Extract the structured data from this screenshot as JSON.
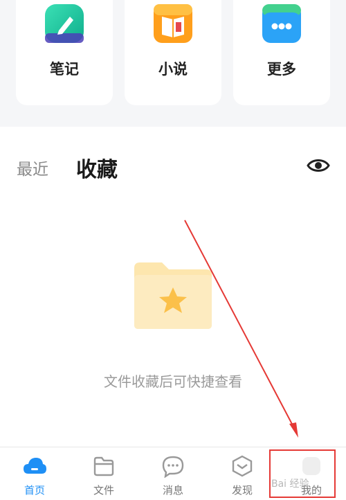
{
  "shortcuts": [
    {
      "label": "笔记",
      "icon": "note-pen-icon"
    },
    {
      "label": "小说",
      "icon": "open-book-icon"
    },
    {
      "label": "更多",
      "icon": "more-dots-icon"
    }
  ],
  "section": {
    "tab_recent": "最近",
    "tab_favorite": "收藏",
    "eye_icon": "eye-icon"
  },
  "empty_state": {
    "icon": "star-folder-icon",
    "text": "文件收藏后可快捷查看"
  },
  "bottom_nav": {
    "items": [
      {
        "label": "首页",
        "icon": "cloud-home-icon",
        "active": true
      },
      {
        "label": "文件",
        "icon": "folder-icon",
        "active": false
      },
      {
        "label": "消息",
        "icon": "chat-bubble-icon",
        "active": false
      },
      {
        "label": "发现",
        "icon": "discover-icon",
        "active": false
      },
      {
        "label": "我的",
        "icon": "profile-icon",
        "active": false
      }
    ]
  },
  "watermark": "Bai 经验",
  "colors": {
    "accent": "#1e8ff5",
    "highlight": "#e53935",
    "note_green": "#17c29a",
    "book_orange": "#ff9f1c",
    "more_blue": "#2ba3f7",
    "folder_yellow": "#fde6ae"
  }
}
